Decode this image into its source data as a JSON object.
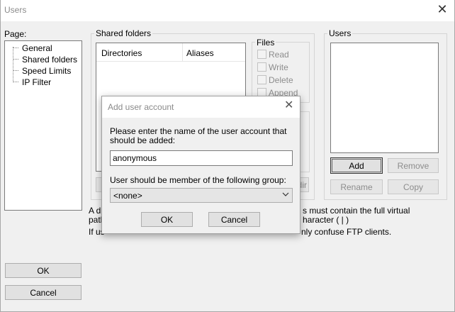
{
  "window": {
    "title": "Users"
  },
  "page_panel": {
    "label": "Page:",
    "items": [
      "General",
      "Shared folders",
      "Speed Limits",
      "IP Filter"
    ]
  },
  "shared_folders": {
    "group_label": "Shared folders",
    "columns": [
      "Directories",
      "Aliases"
    ],
    "note_line1_left": "A di",
    "note_line1_right": "s must contain the full virtual",
    "note_line2_left": "path",
    "note_line2_right": "haracter ( | )",
    "note_line3_left": "If us",
    "note_line3_right": "nly confuse FTP clients.",
    "partial_button": "dir"
  },
  "files_group": {
    "label": "Files",
    "options": [
      "Read",
      "Write",
      "Delete",
      "Append"
    ]
  },
  "users_group": {
    "label": "Users",
    "add": "Add",
    "remove": "Remove",
    "rename": "Rename",
    "copy": "Copy"
  },
  "main_buttons": {
    "ok": "OK",
    "cancel": "Cancel"
  },
  "dialog": {
    "title": "Add user account",
    "prompt": "Please enter the name of the user account that should be added:",
    "name_value": "anonymous",
    "group_prompt": "User should be member of the following group:",
    "group_value": "<none>",
    "ok": "OK",
    "cancel": "Cancel"
  },
  "icons": {
    "close": "close-icon",
    "dropdown": "chevron-down-icon"
  }
}
